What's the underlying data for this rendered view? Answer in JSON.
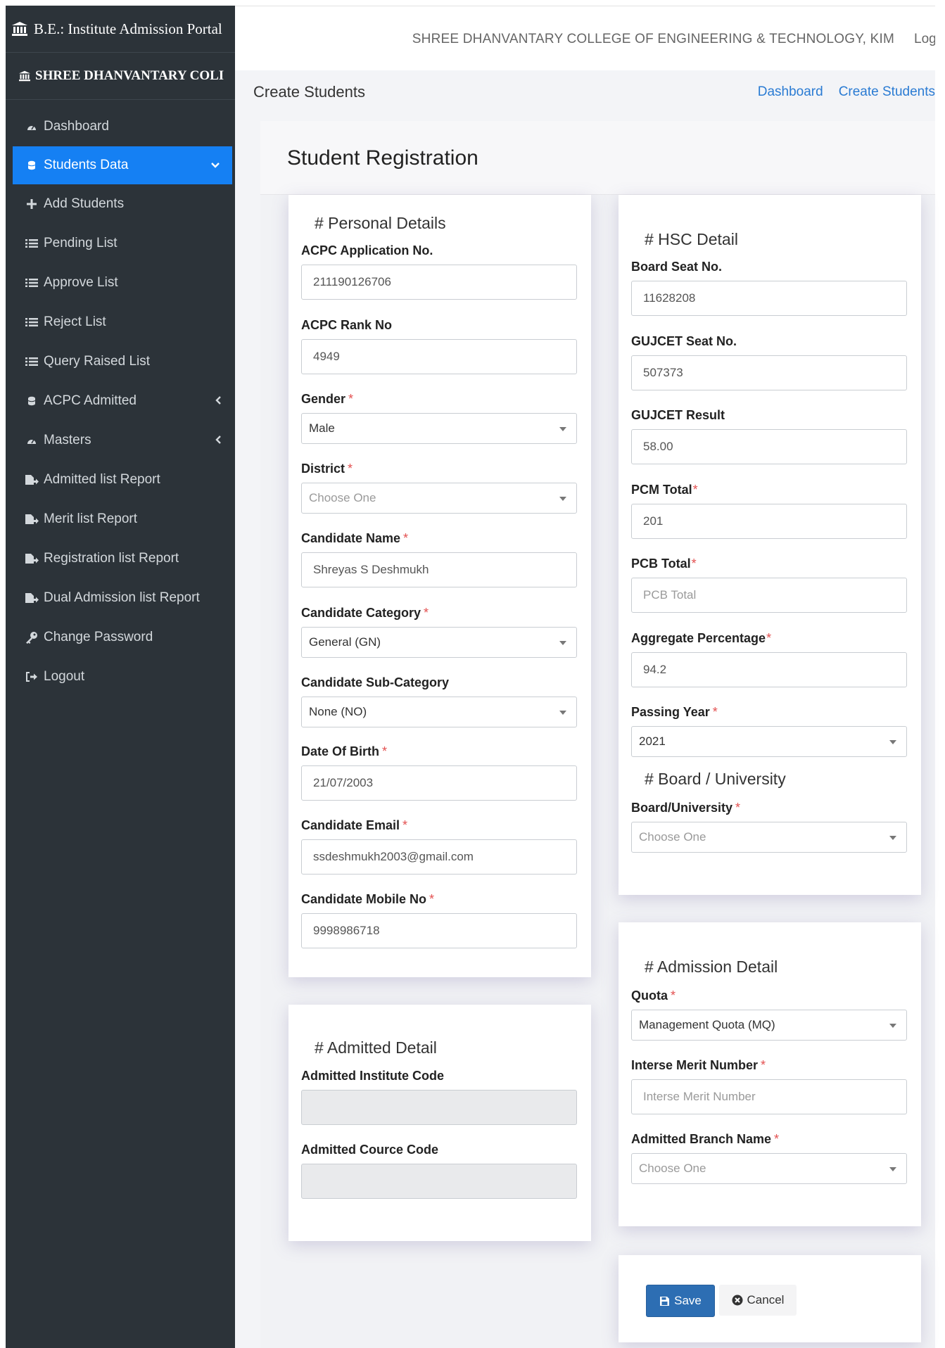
{
  "sidebar": {
    "app_title": "B.E.: Institute Admission Portal",
    "college_short": "SHREE DHANVANTARY COLI",
    "items": [
      {
        "label": "Dashboard",
        "icon": "dashboard-icon"
      },
      {
        "label": "Students Data",
        "icon": "database-icon",
        "active": true
      },
      {
        "label": "Add Students",
        "icon": "plus-icon"
      },
      {
        "label": "Pending List",
        "icon": "list-icon"
      },
      {
        "label": "Approve List",
        "icon": "list-icon"
      },
      {
        "label": "Reject List",
        "icon": "list-icon"
      },
      {
        "label": "Query Raised List",
        "icon": "list-icon"
      },
      {
        "label": "ACPC Admitted",
        "icon": "database-icon"
      },
      {
        "label": "Masters",
        "icon": "dashboard-icon"
      },
      {
        "label": "Admitted list Report",
        "icon": "report-icon"
      },
      {
        "label": "Merit list Report",
        "icon": "report-icon"
      },
      {
        "label": "Registration list Report",
        "icon": "report-icon"
      },
      {
        "label": "Dual Admission list Report",
        "icon": "report-icon"
      },
      {
        "label": "Change Password",
        "icon": "key-icon"
      },
      {
        "label": "Logout",
        "icon": "sign-out-icon"
      }
    ]
  },
  "topbar": {
    "institute": "SHREE DHANVANTARY COLLEGE OF ENGINEERING & TECHNOLOGY, KIM",
    "logout": "Logout"
  },
  "page": {
    "title": "Create Students",
    "breadcrumbs": [
      "Dashboard",
      "Create Students"
    ],
    "form_title": "Student Registration"
  },
  "personal": {
    "heading": "# Personal Details",
    "acpc_app_label": "ACPC Application No.",
    "acpc_app_value": "211190126706",
    "acpc_rank_label": "ACPC Rank No",
    "acpc_rank_value": "4949",
    "gender_label": "Gender",
    "gender_value": "Male",
    "district_label": "District",
    "district_value": "Choose One",
    "name_label": "Candidate Name",
    "name_value": "Shreyas S Deshmukh",
    "category_label": "Candidate Category",
    "category_value": "General (GN)",
    "subcategory_label": "Candidate Sub-Category",
    "subcategory_value": "None (NO)",
    "dob_label": "Date Of Birth",
    "dob_value": "21/07/2003",
    "email_label": "Candidate Email",
    "email_value": "ssdeshmukh2003@gmail.com",
    "mobile_label": "Candidate Mobile No",
    "mobile_value": "9998986718",
    "required_mark": "*"
  },
  "hsc": {
    "heading": "# HSC Detail",
    "board_seat_label": "Board Seat No.",
    "board_seat_value": "11628208",
    "gujcet_seat_label": "GUJCET Seat No.",
    "gujcet_seat_value": "507373",
    "gujcet_result_label": "GUJCET Result",
    "gujcet_result_value": "58.00",
    "pcm_label": "PCM Total",
    "pcm_value": "201",
    "pcb_label": "PCB Total",
    "pcb_placeholder": "PCB Total",
    "aggregate_label": "Aggregate Percentage",
    "aggregate_value": "94.2",
    "passing_label": "Passing Year",
    "passing_value": "2021",
    "board_heading": "# Board / University",
    "board_label": "Board/University",
    "board_value": "Choose One"
  },
  "admitted": {
    "heading": "# Admitted Detail",
    "inst_code_label": "Admitted Institute Code",
    "inst_code_value": "",
    "course_code_label": "Admitted Cource Code",
    "course_code_value": ""
  },
  "admission": {
    "heading": "# Admission Detail",
    "quota_label": "Quota",
    "quota_value": "Management Quota (MQ)",
    "merit_label": "Interse Merit Number",
    "merit_placeholder": "Interse Merit Number",
    "branch_label": "Admitted Branch Name",
    "branch_value": "Choose One"
  },
  "actions": {
    "save": "Save",
    "cancel": "Cancel"
  },
  "colors": {
    "sidebar_bg": "#2c3339",
    "active_item": "#1580f3",
    "link": "#2a7bd3",
    "save_button": "#2d6eb3",
    "required": "#e35050"
  }
}
